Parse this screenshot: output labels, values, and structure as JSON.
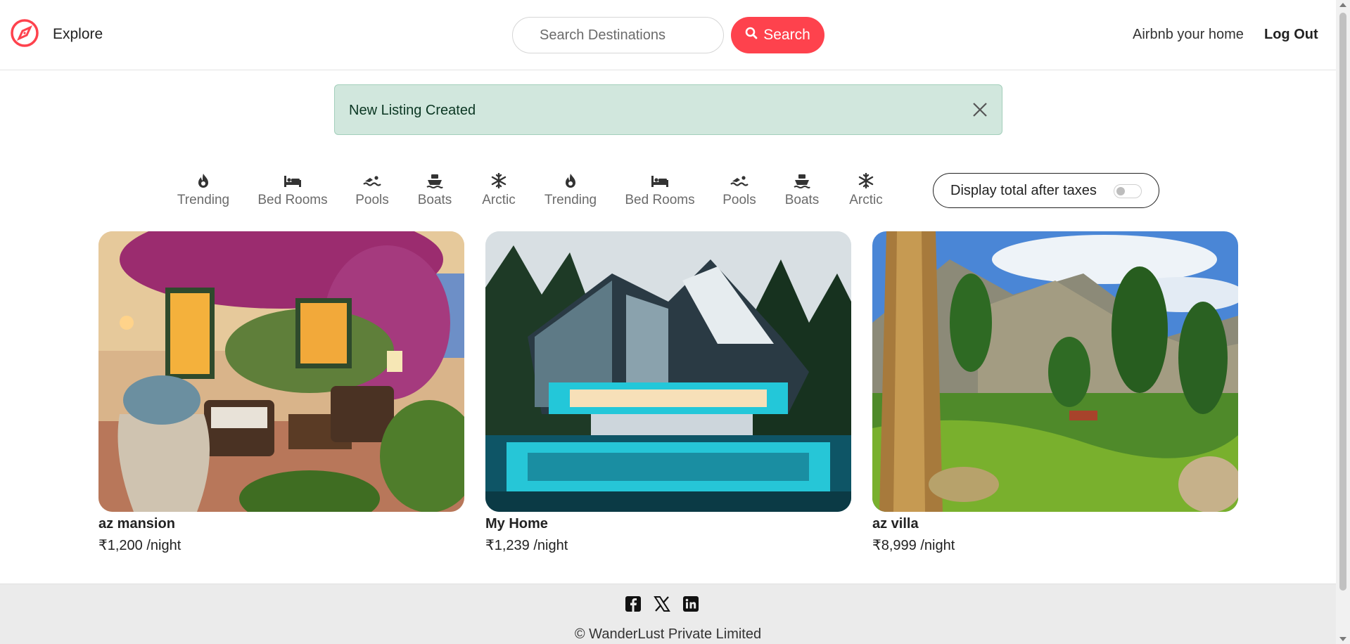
{
  "navbar": {
    "explore_label": "Explore",
    "search_placeholder": "Search Destinations",
    "search_button_label": "Search",
    "host_link_label": "Airbnb your home",
    "logout_label": "Log Out",
    "brand_icon": "compass-icon",
    "accent_color": "#fe424d"
  },
  "alert": {
    "message": "New Listing Created",
    "close_icon": "close-icon",
    "background_color": "#d1e7dd"
  },
  "filters": [
    {
      "label": "Trending",
      "icon": "fire-icon"
    },
    {
      "label": "Bed Rooms",
      "icon": "bed-icon"
    },
    {
      "label": "Pools",
      "icon": "swimmer-icon"
    },
    {
      "label": "Boats",
      "icon": "ship-icon"
    },
    {
      "label": "Arctic",
      "icon": "snowflake-icon"
    },
    {
      "label": "Trending",
      "icon": "fire-icon"
    },
    {
      "label": "Bed Rooms",
      "icon": "bed-icon"
    },
    {
      "label": "Pools",
      "icon": "swimmer-icon"
    },
    {
      "label": "Boats",
      "icon": "ship-icon"
    },
    {
      "label": "Arctic",
      "icon": "snowflake-icon"
    }
  ],
  "tax_toggle": {
    "label": "Display total after taxes",
    "enabled": false
  },
  "listings": [
    {
      "title": "az mansion",
      "price": "₹1,200 /night",
      "image": "flowered-terrace-photo"
    },
    {
      "title": "My Home",
      "price": "₹1,239 /night",
      "image": "modern-glass-house-photo"
    },
    {
      "title": "az villa",
      "price": "₹8,999 /night",
      "image": "mountain-valley-photo"
    }
  ],
  "footer": {
    "socials": [
      "facebook-icon",
      "x-twitter-icon",
      "linkedin-icon"
    ],
    "copyright": "© WanderLust Private Limited"
  }
}
